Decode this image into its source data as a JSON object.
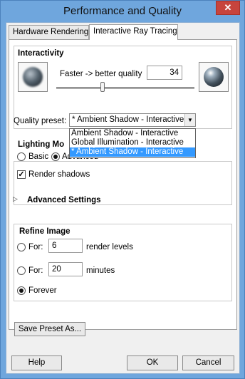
{
  "window": {
    "title": "Performance and Quality",
    "close_glyph": "✕"
  },
  "tabs": [
    {
      "label": "Hardware Rendering"
    },
    {
      "label": "Interactive Ray Tracing"
    }
  ],
  "interactivity": {
    "heading": "Interactivity",
    "slider_label": "Faster -> better quality",
    "quality_value": "34",
    "slider_level": 0.33,
    "left_icon": "low-quality-sphere-icon",
    "right_icon": "high-quality-sphere-icon"
  },
  "preset": {
    "label": "Quality preset:",
    "selected": "* Ambient Shadow - Interactive",
    "options": [
      "Ambient Shadow - Interactive",
      "Global Illumination - Interactive",
      "* Ambient Shadow - Interactive"
    ]
  },
  "lighting": {
    "heading": "Lighting Mo",
    "basic": "Basic",
    "advanced": "Advanced",
    "render_shadows": "Render shadows"
  },
  "advanced_settings": {
    "label": "Advanced Settings"
  },
  "refine": {
    "heading": "Refine Image",
    "for_label": "For:",
    "levels_value": "6",
    "levels_unit": "render levels",
    "minutes_value": "20",
    "minutes_unit": "minutes",
    "forever": "Forever"
  },
  "buttons": {
    "save_preset": "Save Preset As...",
    "help": "Help",
    "ok": "OK",
    "cancel": "Cancel"
  },
  "colors": {
    "frame": "#6fa6dd",
    "close": "#c7443d",
    "selection": "#3399ff"
  }
}
